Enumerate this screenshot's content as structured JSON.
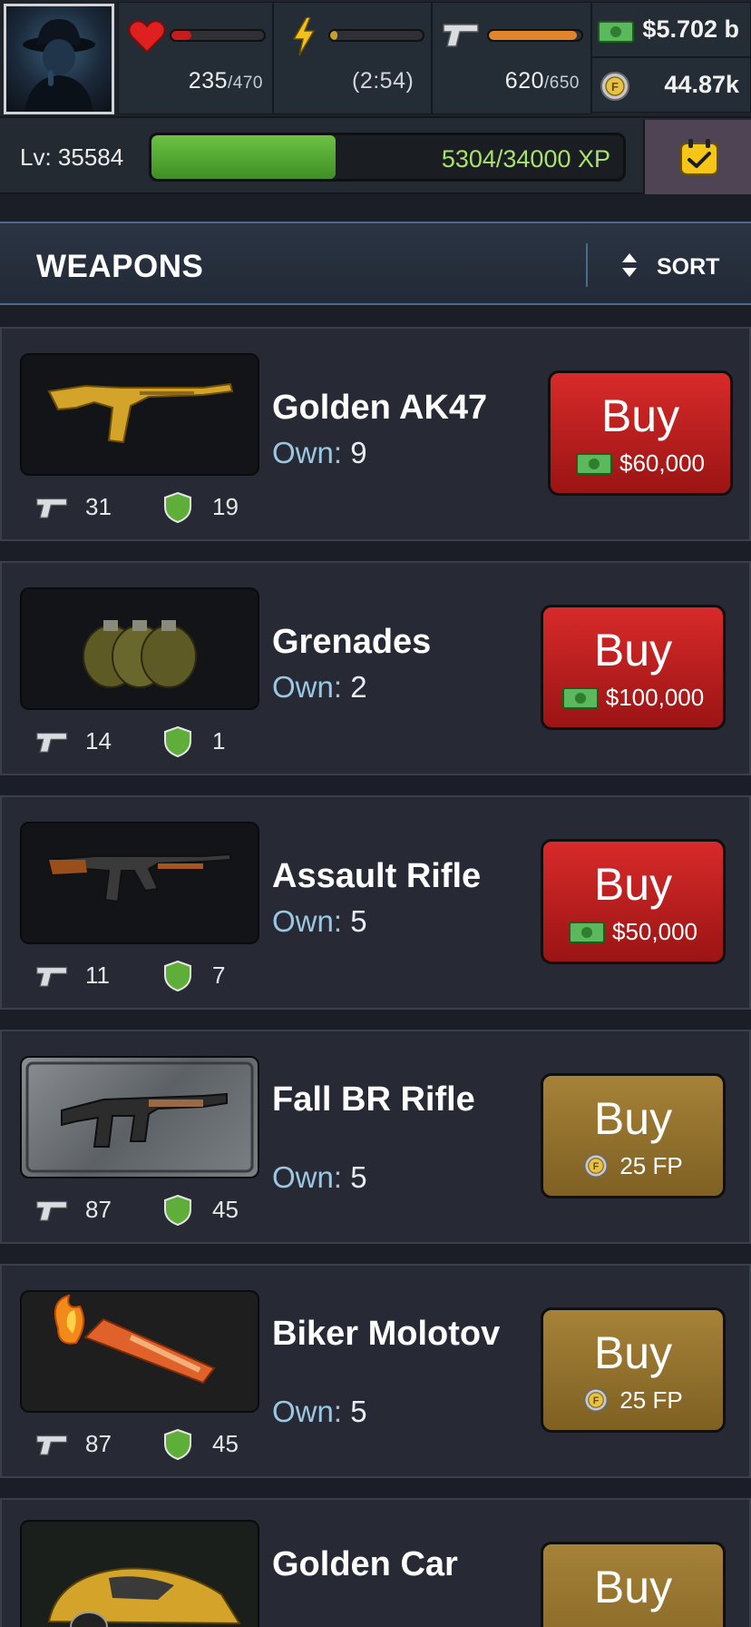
{
  "stats": {
    "health": {
      "value": "235",
      "max": "/470",
      "fill": 0.22,
      "color": "#c71c1c"
    },
    "energy": {
      "timer": "(2:54)",
      "fill": 0.08,
      "color": "#c9a12a"
    },
    "stamina": {
      "value": "620",
      "max": "/650",
      "fill": 0.95,
      "color": "#e0852e"
    },
    "cash": "$5.702 b",
    "fp": "44.87k"
  },
  "level": {
    "label": "Lv: 35584",
    "xp_text": "5304/34000 XP",
    "xp_fill": 0.39
  },
  "section": {
    "title": "WEAPONS",
    "sort_label": "SORT"
  },
  "own_label": "Own: ",
  "buy_label": "Buy",
  "items": [
    {
      "name": "Golden AK47",
      "own": "9",
      "attack": "31",
      "defense": "19",
      "price": "$60,000",
      "currency": "cash"
    },
    {
      "name": "Grenades",
      "own": "2",
      "attack": "14",
      "defense": "1",
      "price": "$100,000",
      "currency": "cash"
    },
    {
      "name": "Assault Rifle",
      "own": "5",
      "attack": "11",
      "defense": "7",
      "price": "$50,000",
      "currency": "cash"
    },
    {
      "name": "Fall BR Rifle",
      "own": "5",
      "attack": "87",
      "defense": "45",
      "price": "25 FP",
      "currency": "fp"
    },
    {
      "name": "Biker Molotov",
      "own": "5",
      "attack": "87",
      "defense": "45",
      "price": "25 FP",
      "currency": "fp"
    },
    {
      "name": "Golden Car",
      "own": "",
      "attack": "",
      "defense": "",
      "price": "",
      "currency": "fp"
    }
  ],
  "icons": {
    "heart": "heart-icon",
    "energy": "lightning-icon",
    "stamina": "pistol-icon",
    "cash": "cash-icon",
    "fp": "fp-coin-icon",
    "calendar": "calendar-check-icon",
    "sort": "sort-arrows-icon",
    "attack": "pistol-icon",
    "defense": "shield-icon"
  }
}
